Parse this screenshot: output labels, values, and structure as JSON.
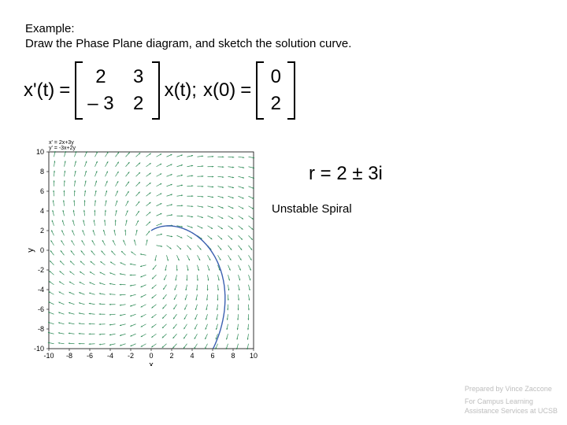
{
  "header": {
    "line1": "Example:",
    "line2": "Draw the Phase Plane diagram, and sketch the solution curve."
  },
  "equation": {
    "lhs": "x'(t)",
    "matrix": {
      "a11": "2",
      "a12": "3",
      "a21": "– 3",
      "a22": "2"
    },
    "mid_lhs": "x(t);",
    "ic_lhs": "x(0)",
    "ic_vec": {
      "v1": "0",
      "v2": "2"
    },
    "equals": "="
  },
  "eigen": {
    "label": "r = 2 ± 3i"
  },
  "classification": "Unstable Spiral",
  "footer": {
    "line1": "Prepared by Vince Zaccone",
    "line2": "For Campus Learning",
    "line3": "Assistance Services at UCSB"
  },
  "chart_data": {
    "type": "vector-field",
    "title_top": "x' = 2x+3y",
    "title_bottom": "y' = -3x+2y",
    "xlabel": "x",
    "ylabel": "y",
    "xlim": [
      -10,
      10
    ],
    "ylim": [
      -10,
      10
    ],
    "xticks": [
      -10,
      -8,
      -6,
      -4,
      -2,
      0,
      2,
      4,
      6,
      8,
      10
    ],
    "yticks": [
      -10,
      -8,
      -6,
      -4,
      -2,
      0,
      2,
      4,
      6,
      8,
      10
    ],
    "field_equations": {
      "dx": "2*x + 3*y",
      "dy": "-3*x + 2*y"
    },
    "trajectory": {
      "initial": [
        0,
        2
      ],
      "description": "outward (unstable) clockwise spiral from near origin toward edge"
    }
  }
}
